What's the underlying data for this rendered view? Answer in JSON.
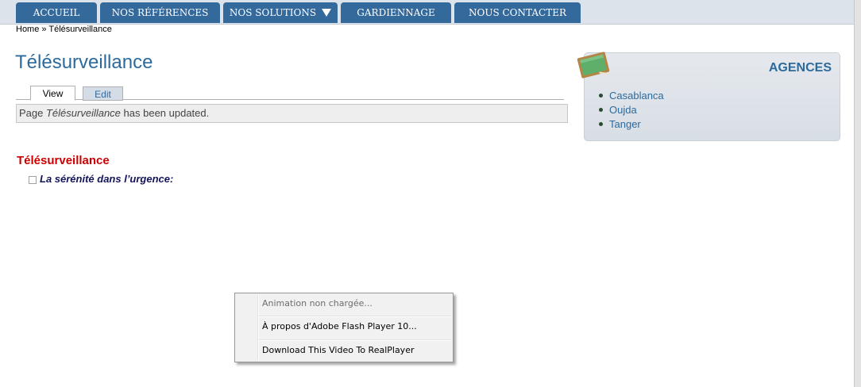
{
  "nav": {
    "items": [
      {
        "label": "ACCUEIL"
      },
      {
        "label": "NOS RÉFÉRENCES"
      },
      {
        "label": "NOS SOLUTIONS"
      },
      {
        "label": "GARDIENNAGE"
      },
      {
        "label": "NOUS CONTACTER"
      }
    ],
    "dropdown_icon": "triangle-down-icon"
  },
  "breadcrumb": "Home » Télésurveillance",
  "page": {
    "title": "Télésurveillance",
    "tabs": [
      {
        "label": "View"
      },
      {
        "label": "Edit"
      }
    ],
    "status": {
      "prefix": "Page ",
      "name": "Télésurveillance",
      "suffix": " has been updated."
    }
  },
  "content": {
    "heading": "Télésurveillance",
    "subheading": "La sérénité dans l’urgence:"
  },
  "agences": {
    "title": "AGENCES",
    "icon": "chalkboard-icon",
    "items": [
      {
        "label": "Casablanca"
      },
      {
        "label": "Oujda"
      },
      {
        "label": "Tanger"
      }
    ]
  },
  "context_menu": {
    "items": [
      {
        "label": "Animation non chargée...",
        "disabled": true
      },
      {
        "label": "À propos d'Adobe Flash Player 10..."
      },
      {
        "label": "Download This Video To RealPlayer"
      }
    ]
  },
  "colors": {
    "nav_bg": "#33699b",
    "link": "#2d6a9c",
    "heading_red": "#cc0000",
    "subtitle": "#14145c"
  }
}
